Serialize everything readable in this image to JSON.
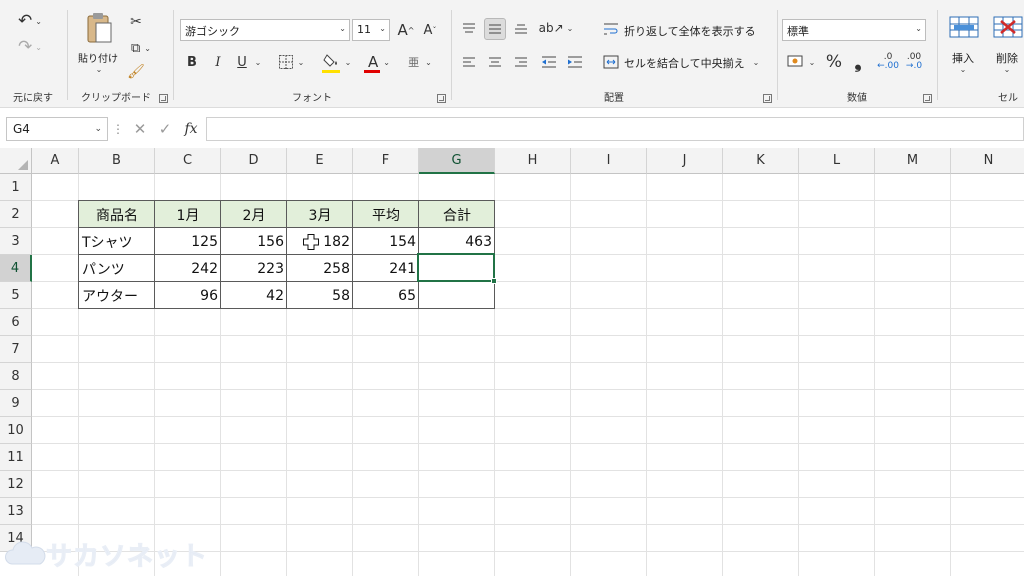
{
  "ribbon": {
    "undo_group": {
      "label": "元に戻す"
    },
    "clipboard": {
      "paste_label": "貼り付け",
      "label": "クリップボード"
    },
    "font": {
      "name": "游ゴシック",
      "size": "11",
      "bold": "B",
      "italic": "I",
      "underline": "U",
      "grow": "A",
      "shrink": "A",
      "furigana": "亜",
      "color_letter": "A",
      "label": "フォント",
      "fill_color": "#ffe000",
      "font_color": "#e00000"
    },
    "alignment": {
      "wrap_text": "折り返して全体を表示する",
      "merge_center": "セルを結合して中央揃え",
      "label": "配置"
    },
    "number": {
      "format": "標準",
      "percent": "%",
      "comma": "❟",
      "label": "数値"
    },
    "cells": {
      "insert": "挿入",
      "delete": "削除",
      "label": "セル"
    }
  },
  "formula_bar": {
    "name_box": "G4",
    "fx": "fx",
    "value": ""
  },
  "grid": {
    "columns": [
      "A",
      "B",
      "C",
      "D",
      "E",
      "F",
      "G",
      "H",
      "I",
      "J",
      "K",
      "L",
      "M",
      "N"
    ],
    "rows": [
      "1",
      "2",
      "3",
      "4",
      "5",
      "6",
      "7",
      "8",
      "9",
      "10",
      "11",
      "12",
      "13",
      "14"
    ],
    "selected_column": "G",
    "selected_row": "4",
    "table": {
      "headers": [
        "商品名",
        "1月",
        "2月",
        "3月",
        "平均",
        "合計"
      ],
      "rows": [
        [
          "Tシャツ",
          "125",
          "156",
          "182",
          "154",
          "463"
        ],
        [
          "パンツ",
          "242",
          "223",
          "258",
          "241",
          ""
        ],
        [
          "アウター",
          "96",
          "42",
          "58",
          "65",
          ""
        ]
      ]
    }
  },
  "watermark": "サカソネット",
  "accent": "#217346"
}
